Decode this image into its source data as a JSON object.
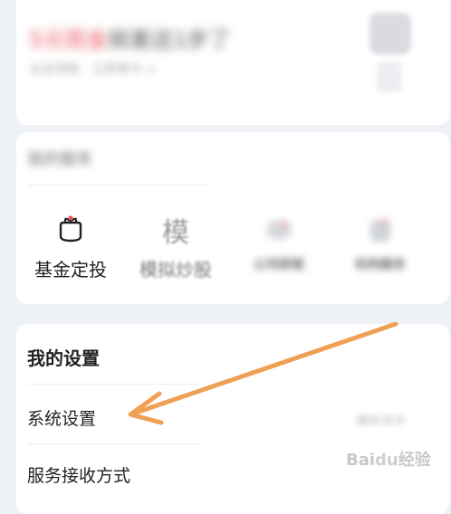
{
  "promo": {
    "title_accent": "5元现金",
    "title_rest": "就差这1步了",
    "subtitle": "点击领取 · 立即参与 >"
  },
  "services": {
    "title": "我的服务",
    "items": [
      {
        "label": "基金定投",
        "icon": "wallet-icon"
      },
      {
        "label": "模拟炒股",
        "icon": "mo-glyph-icon",
        "glyph": "模"
      },
      {
        "label": "公司研报",
        "icon": "report-icon"
      },
      {
        "label": "机构服务",
        "icon": "service-icon"
      }
    ]
  },
  "settings": {
    "title": "我的设置",
    "rows": [
      {
        "label": "系统设置"
      },
      {
        "label": "服务接收方式"
      }
    ],
    "right_text": "通知/显示"
  },
  "watermark": {
    "brand": "Bai",
    "paw": "du",
    "suffix": "经验"
  },
  "colors": {
    "arrow": "#f0a055",
    "accent": "#e8525f"
  }
}
